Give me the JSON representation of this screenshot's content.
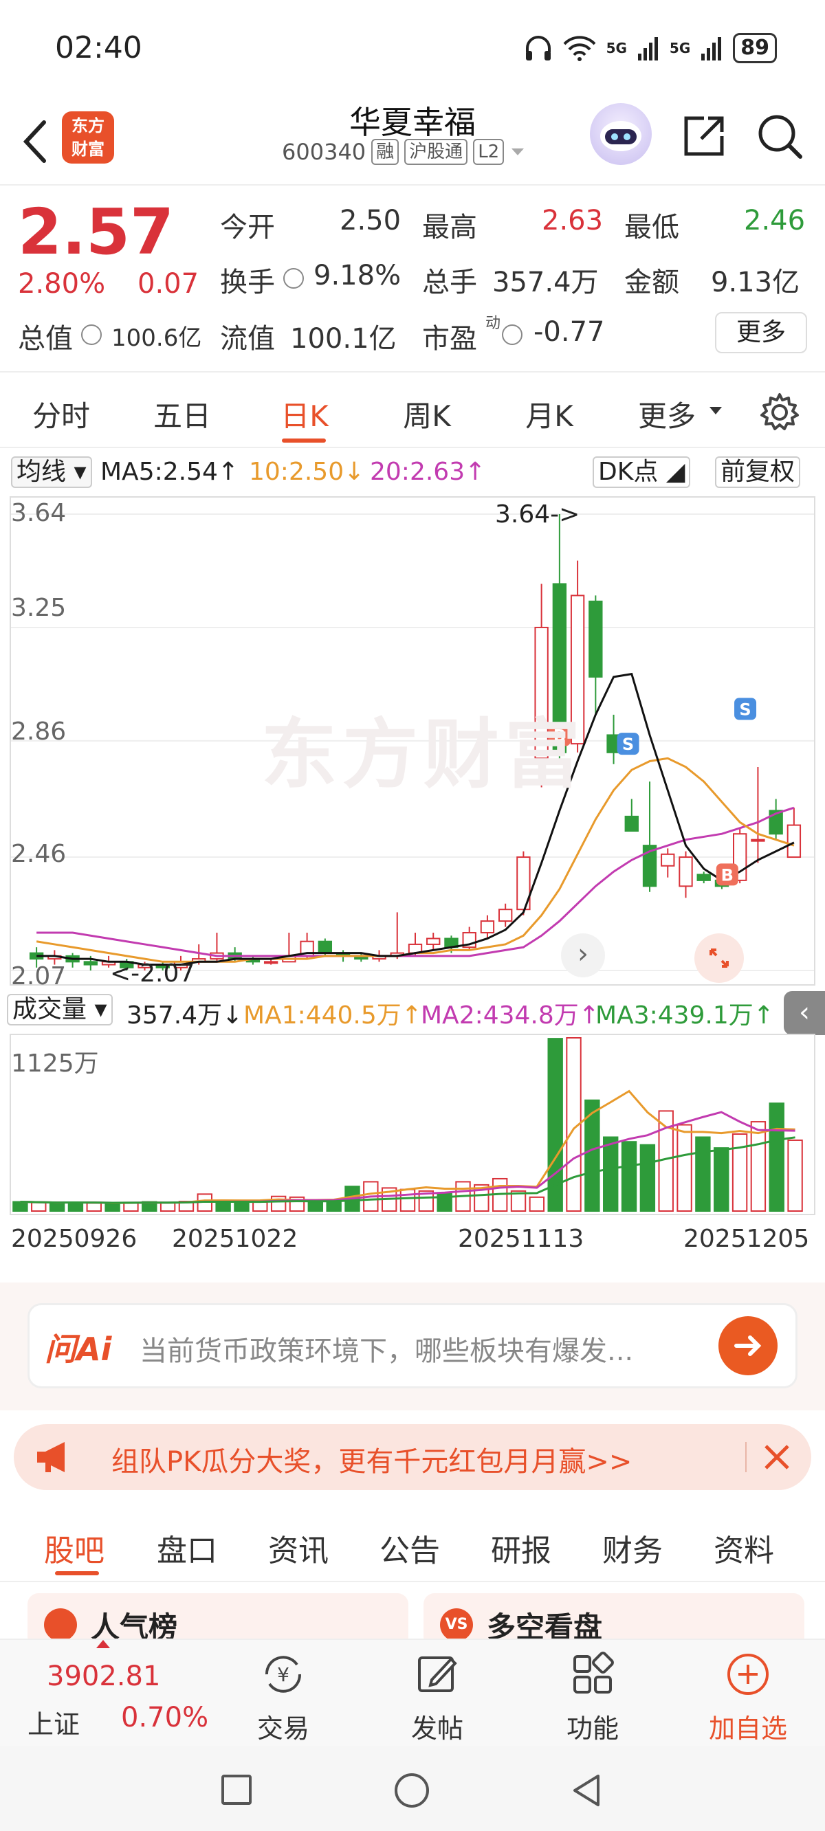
{
  "status": {
    "time": "02:40",
    "signal1": "5G",
    "signal2": "5G",
    "battery": "89"
  },
  "header": {
    "logo_text": "东方财富",
    "title": "华夏幸福",
    "code": "600340",
    "tags": [
      "融",
      "沪股通",
      "L2"
    ]
  },
  "quote": {
    "price": "2.57",
    "pct": "2.80%",
    "chg": "0.07",
    "open_label": "今开",
    "open": "2.50",
    "high_label": "最高",
    "high": "2.63",
    "low_label": "最低",
    "low": "2.46",
    "turnover_label": "换手",
    "turnover": "9.18%",
    "vol_label": "总手",
    "vol": "357.4万",
    "amount_label": "金额",
    "amount": "9.13亿",
    "mcap_label": "总值",
    "mcap": "100.6亿",
    "float_label": "流值",
    "float": "100.1亿",
    "pe_label": "市盈",
    "pe_sup": "动",
    "pe": "-0.77",
    "more": "更多"
  },
  "tabs": [
    "分时",
    "五日",
    "日K",
    "周K",
    "月K",
    "更多"
  ],
  "ma": {
    "select": "均线",
    "ma5": "MA5:2.54↑",
    "ma10": "10:2.50↓",
    "ma20": "20:2.63↑",
    "dk": "DK点",
    "fq": "前复权"
  },
  "colors": {
    "up": "#d9323a",
    "down": "#2e9b3a",
    "accent": "#e8502a",
    "ma5": "#111111",
    "ma10": "#e89a2c",
    "ma20": "#c23bb0"
  },
  "chart_data": {
    "type": "candlestick",
    "y_ticks": [
      "3.64",
      "3.25",
      "2.86",
      "2.46",
      "2.07"
    ],
    "ylim": [
      2.07,
      3.64
    ],
    "annotations": {
      "high_marker": "3.64->",
      "low_marker": "<-2.07",
      "watermark": "东方财富",
      "b": "B",
      "s": "S"
    },
    "candles": [
      {
        "o": 2.13,
        "c": 2.11,
        "h": 2.15,
        "l": 2.08
      },
      {
        "o": 2.11,
        "c": 2.12,
        "h": 2.14,
        "l": 2.09
      },
      {
        "o": 2.12,
        "c": 2.1,
        "h": 2.13,
        "l": 2.08
      },
      {
        "o": 2.1,
        "c": 2.09,
        "h": 2.12,
        "l": 2.07
      },
      {
        "o": 2.09,
        "c": 2.1,
        "h": 2.12,
        "l": 2.08
      },
      {
        "o": 2.1,
        "c": 2.08,
        "h": 2.11,
        "l": 2.07
      },
      {
        "o": 2.08,
        "c": 2.09,
        "h": 2.1,
        "l": 2.07
      },
      {
        "o": 2.09,
        "c": 2.08,
        "h": 2.1,
        "l": 2.07
      },
      {
        "o": 2.08,
        "c": 2.1,
        "h": 2.12,
        "l": 2.07
      },
      {
        "o": 2.1,
        "c": 2.11,
        "h": 2.16,
        "l": 2.09
      },
      {
        "o": 2.11,
        "c": 2.13,
        "h": 2.2,
        "l": 2.1
      },
      {
        "o": 2.13,
        "c": 2.11,
        "h": 2.15,
        "l": 2.1
      },
      {
        "o": 2.11,
        "c": 2.1,
        "h": 2.12,
        "l": 2.09
      },
      {
        "o": 2.1,
        "c": 2.1,
        "h": 2.11,
        "l": 2.09
      },
      {
        "o": 2.1,
        "c": 2.12,
        "h": 2.2,
        "l": 2.1
      },
      {
        "o": 2.12,
        "c": 2.17,
        "h": 2.2,
        "l": 2.11
      },
      {
        "o": 2.17,
        "c": 2.13,
        "h": 2.18,
        "l": 2.12
      },
      {
        "o": 2.13,
        "c": 2.12,
        "h": 2.14,
        "l": 2.1
      },
      {
        "o": 2.12,
        "c": 2.11,
        "h": 2.13,
        "l": 2.1
      },
      {
        "o": 2.11,
        "c": 2.12,
        "h": 2.14,
        "l": 2.1
      },
      {
        "o": 2.12,
        "c": 2.13,
        "h": 2.27,
        "l": 2.11
      },
      {
        "o": 2.13,
        "c": 2.16,
        "h": 2.2,
        "l": 2.12
      },
      {
        "o": 2.16,
        "c": 2.18,
        "h": 2.2,
        "l": 2.14
      },
      {
        "o": 2.18,
        "c": 2.15,
        "h": 2.19,
        "l": 2.13
      },
      {
        "o": 2.15,
        "c": 2.2,
        "h": 2.22,
        "l": 2.14
      },
      {
        "o": 2.2,
        "c": 2.24,
        "h": 2.26,
        "l": 2.18
      },
      {
        "o": 2.24,
        "c": 2.28,
        "h": 2.3,
        "l": 2.22
      },
      {
        "o": 2.28,
        "c": 2.46,
        "h": 2.48,
        "l": 2.26
      },
      {
        "o": 2.8,
        "c": 3.25,
        "h": 3.4,
        "l": 2.7
      },
      {
        "o": 3.4,
        "c": 2.82,
        "h": 3.64,
        "l": 2.78
      },
      {
        "o": 2.85,
        "c": 3.36,
        "h": 3.48,
        "l": 2.82
      },
      {
        "o": 3.34,
        "c": 3.08,
        "h": 3.36,
        "l": 2.95
      },
      {
        "o": 2.88,
        "c": 2.82,
        "h": 2.95,
        "l": 2.78
      },
      {
        "o": 2.6,
        "c": 2.55,
        "h": 2.66,
        "l": 2.55
      },
      {
        "o": 2.5,
        "c": 2.36,
        "h": 2.72,
        "l": 2.34
      },
      {
        "o": 2.43,
        "c": 2.47,
        "h": 2.49,
        "l": 2.39
      },
      {
        "o": 2.36,
        "c": 2.46,
        "h": 2.48,
        "l": 2.32
      },
      {
        "o": 2.4,
        "c": 2.38,
        "h": 2.41,
        "l": 2.37
      },
      {
        "o": 2.38,
        "c": 2.36,
        "h": 2.43,
        "l": 2.35
      },
      {
        "o": 2.38,
        "c": 2.54,
        "h": 2.56,
        "l": 2.37
      },
      {
        "o": 2.52,
        "c": 2.52,
        "h": 2.77,
        "l": 2.44
      },
      {
        "o": 2.62,
        "c": 2.54,
        "h": 2.66,
        "l": 2.52
      },
      {
        "o": 2.46,
        "c": 2.57,
        "h": 2.63,
        "l": 2.46
      }
    ],
    "ma5": [
      2.12,
      2.12,
      2.11,
      2.11,
      2.1,
      2.1,
      2.09,
      2.09,
      2.09,
      2.1,
      2.1,
      2.11,
      2.11,
      2.11,
      2.12,
      2.13,
      2.13,
      2.13,
      2.13,
      2.12,
      2.12,
      2.13,
      2.14,
      2.15,
      2.16,
      2.18,
      2.21,
      2.27,
      2.44,
      2.62,
      2.79,
      2.95,
      3.08,
      3.09,
      2.88,
      2.69,
      2.5,
      2.42,
      2.38,
      2.41,
      2.45,
      2.48,
      2.51
    ],
    "ma10": [
      2.17,
      2.16,
      2.15,
      2.14,
      2.13,
      2.12,
      2.11,
      2.1,
      2.1,
      2.1,
      2.1,
      2.1,
      2.11,
      2.11,
      2.11,
      2.11,
      2.12,
      2.12,
      2.12,
      2.12,
      2.12,
      2.13,
      2.13,
      2.14,
      2.14,
      2.15,
      2.16,
      2.19,
      2.26,
      2.35,
      2.47,
      2.59,
      2.69,
      2.76,
      2.79,
      2.8,
      2.77,
      2.72,
      2.65,
      2.58,
      2.54,
      2.52,
      2.5
    ],
    "ma20": [
      2.2,
      2.2,
      2.2,
      2.19,
      2.18,
      2.17,
      2.16,
      2.15,
      2.14,
      2.13,
      2.12,
      2.12,
      2.12,
      2.12,
      2.12,
      2.12,
      2.12,
      2.12,
      2.12,
      2.12,
      2.12,
      2.12,
      2.12,
      2.12,
      2.12,
      2.13,
      2.14,
      2.15,
      2.19,
      2.24,
      2.3,
      2.36,
      2.41,
      2.45,
      2.48,
      2.5,
      2.52,
      2.53,
      2.54,
      2.56,
      2.58,
      2.61,
      2.63
    ]
  },
  "volume": {
    "select": "成交量",
    "vol": "357.4万↓",
    "ma1": "MA1:440.5万↑",
    "ma2": "MA2:434.8万↑",
    "ma3": "MA3:439.1万↑",
    "max_label": "1125万",
    "values": [
      60,
      55,
      50,
      58,
      52,
      48,
      56,
      60,
      55,
      62,
      110,
      60,
      55,
      58,
      95,
      90,
      60,
      65,
      160,
      190,
      150,
      140,
      130,
      115,
      190,
      170,
      210,
      130,
      90,
      1120,
      1125,
      720,
      480,
      450,
      430,
      650,
      560,
      480,
      410,
      500,
      580,
      700,
      460
    ],
    "dates": [
      "20250926",
      "20251022",
      "20251113",
      "20251205"
    ]
  },
  "ai": {
    "logo": "问Ai",
    "placeholder": "当前货币政策环境下，哪些板块有爆发..."
  },
  "banner": {
    "text": "组队PK瓜分大奖，更有千元红包月月赢>>"
  },
  "bottom_tabs": [
    "股吧",
    "盘口",
    "资讯",
    "公告",
    "研报",
    "财务",
    "资料"
  ],
  "cards": [
    "人气榜",
    "多空看盘"
  ],
  "footer": {
    "index_value": "3902.81",
    "index_name": "上证",
    "index_pct": "0.70%",
    "items": [
      "交易",
      "发帖",
      "功能",
      "加自选"
    ]
  }
}
